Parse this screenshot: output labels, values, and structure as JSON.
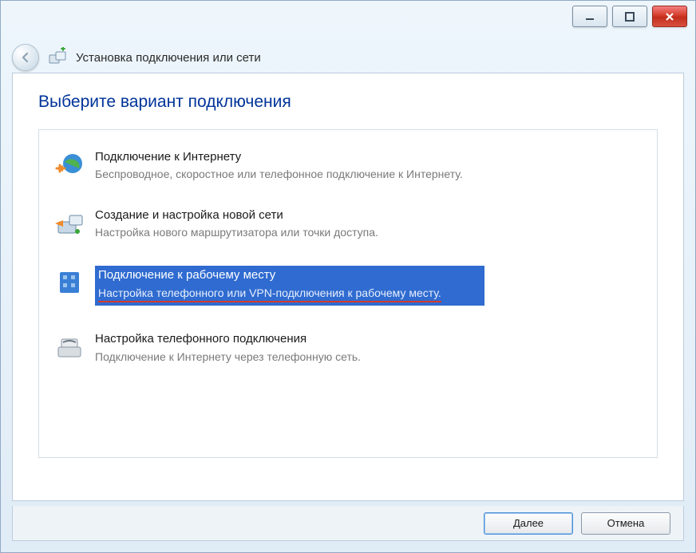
{
  "header": {
    "title": "Установка подключения или сети"
  },
  "page": {
    "heading": "Выберите вариант подключения"
  },
  "options": [
    {
      "title": "Подключение к Интернету",
      "desc": "Беспроводное, скоростное или телефонное подключение к Интернету."
    },
    {
      "title": "Создание и настройка новой сети",
      "desc": "Настройка нового маршрутизатора или точки доступа."
    },
    {
      "title": "Подключение к рабочему месту",
      "desc": "Настройка телефонного или VPN-подключения к рабочему месту."
    },
    {
      "title": "Настройка телефонного подключения",
      "desc": "Подключение к Интернету через телефонную сеть."
    }
  ],
  "footer": {
    "next_label": "Далее",
    "cancel_label": "Отмена"
  }
}
